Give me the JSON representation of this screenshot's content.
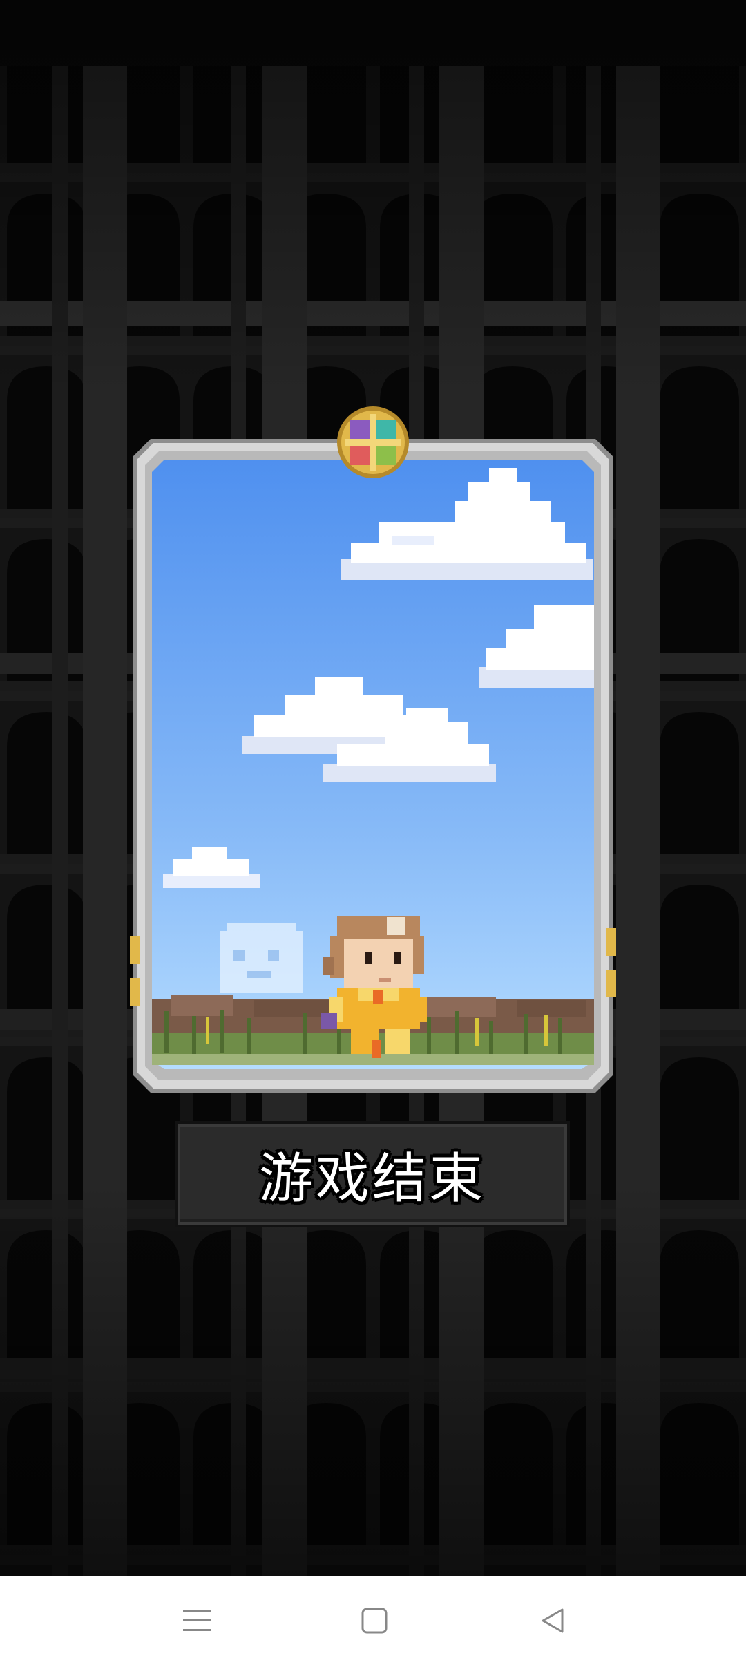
{
  "game": {
    "button_label": "游戏结束",
    "character": "girl-with-brown-hair-in-yellow-outfit",
    "scene": "sky-with-clouds-and-grass"
  },
  "colors": {
    "background": "#0b0b0b",
    "pillar": "#2a2a2a",
    "sky_top": "#4f90ef",
    "sky_bottom": "#b5dcff",
    "card_frame": "#c9c9c9",
    "emblem_gold": "#e1b84a",
    "button_bg": "#2b2b2b",
    "nav_bg": "#ffffff",
    "nav_icon": "#888888"
  },
  "navigation": {
    "menu_icon": "menu-icon",
    "home_icon": "square-home-icon",
    "back_icon": "triangle-back-icon"
  }
}
